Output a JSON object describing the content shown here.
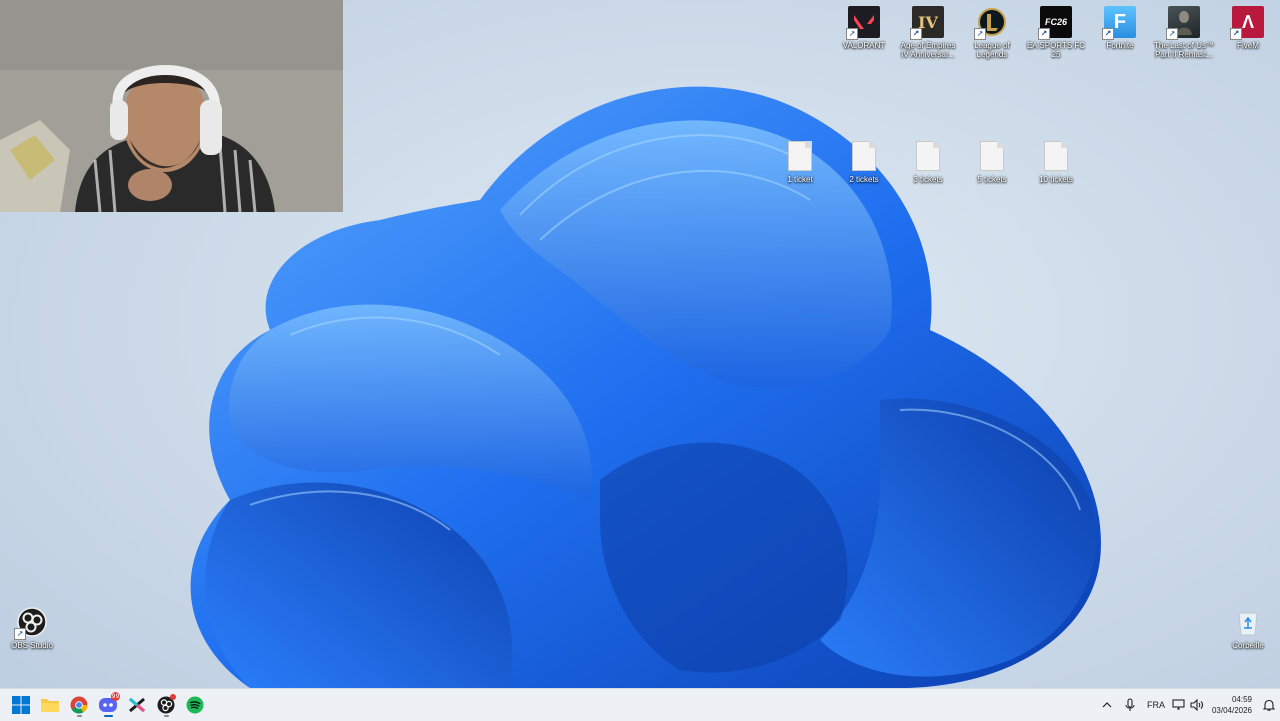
{
  "desktop": {
    "shortcuts": [
      {
        "label": "VALORANT",
        "icon": "valorant-icon"
      },
      {
        "label": "Age of Empires IV Anniversar...",
        "icon": "age-of-empires-icon"
      },
      {
        "label": "League of Legends",
        "icon": "league-of-legends-icon"
      },
      {
        "label": "EA SPORTS FC 25",
        "icon": "ea-sports-fc-icon"
      },
      {
        "label": "Fortnite",
        "icon": "fortnite-icon"
      },
      {
        "label": "The Last of Us™ Part II Remast...",
        "icon": "last-of-us-icon"
      },
      {
        "label": "FiveM",
        "icon": "fivem-icon"
      }
    ],
    "tile_text": {
      "aoe": "IV",
      "eafc": "FC26",
      "fortnite": "F",
      "fivem": "Λ"
    },
    "files": [
      {
        "label": "1 ticket"
      },
      {
        "label": "2 tickets"
      },
      {
        "label": "3 tickets"
      },
      {
        "label": "5 tickets"
      },
      {
        "label": "10 tickets"
      }
    ],
    "obs": {
      "label": "OBS Studio"
    },
    "recycle_bin": {
      "label": "Corbeille"
    }
  },
  "taskbar": {
    "apps": [
      {
        "name": "start-button",
        "icon": "windows-logo-icon"
      },
      {
        "name": "file-explorer",
        "icon": "folder-icon"
      },
      {
        "name": "chrome",
        "icon": "chrome-icon"
      },
      {
        "name": "discord",
        "icon": "discord-icon",
        "badge": "99"
      },
      {
        "name": "capcut",
        "icon": "capcut-icon"
      },
      {
        "name": "obs",
        "icon": "obs-icon"
      },
      {
        "name": "spotify",
        "icon": "spotify-icon"
      }
    ],
    "tray": {
      "language": "FRA",
      "time": "04:59",
      "date": "03/04/2026"
    }
  },
  "colors": {
    "accent": "#0067c0",
    "valorant": "#fd4556",
    "wallpaper_blue": "#1a6fe8"
  }
}
